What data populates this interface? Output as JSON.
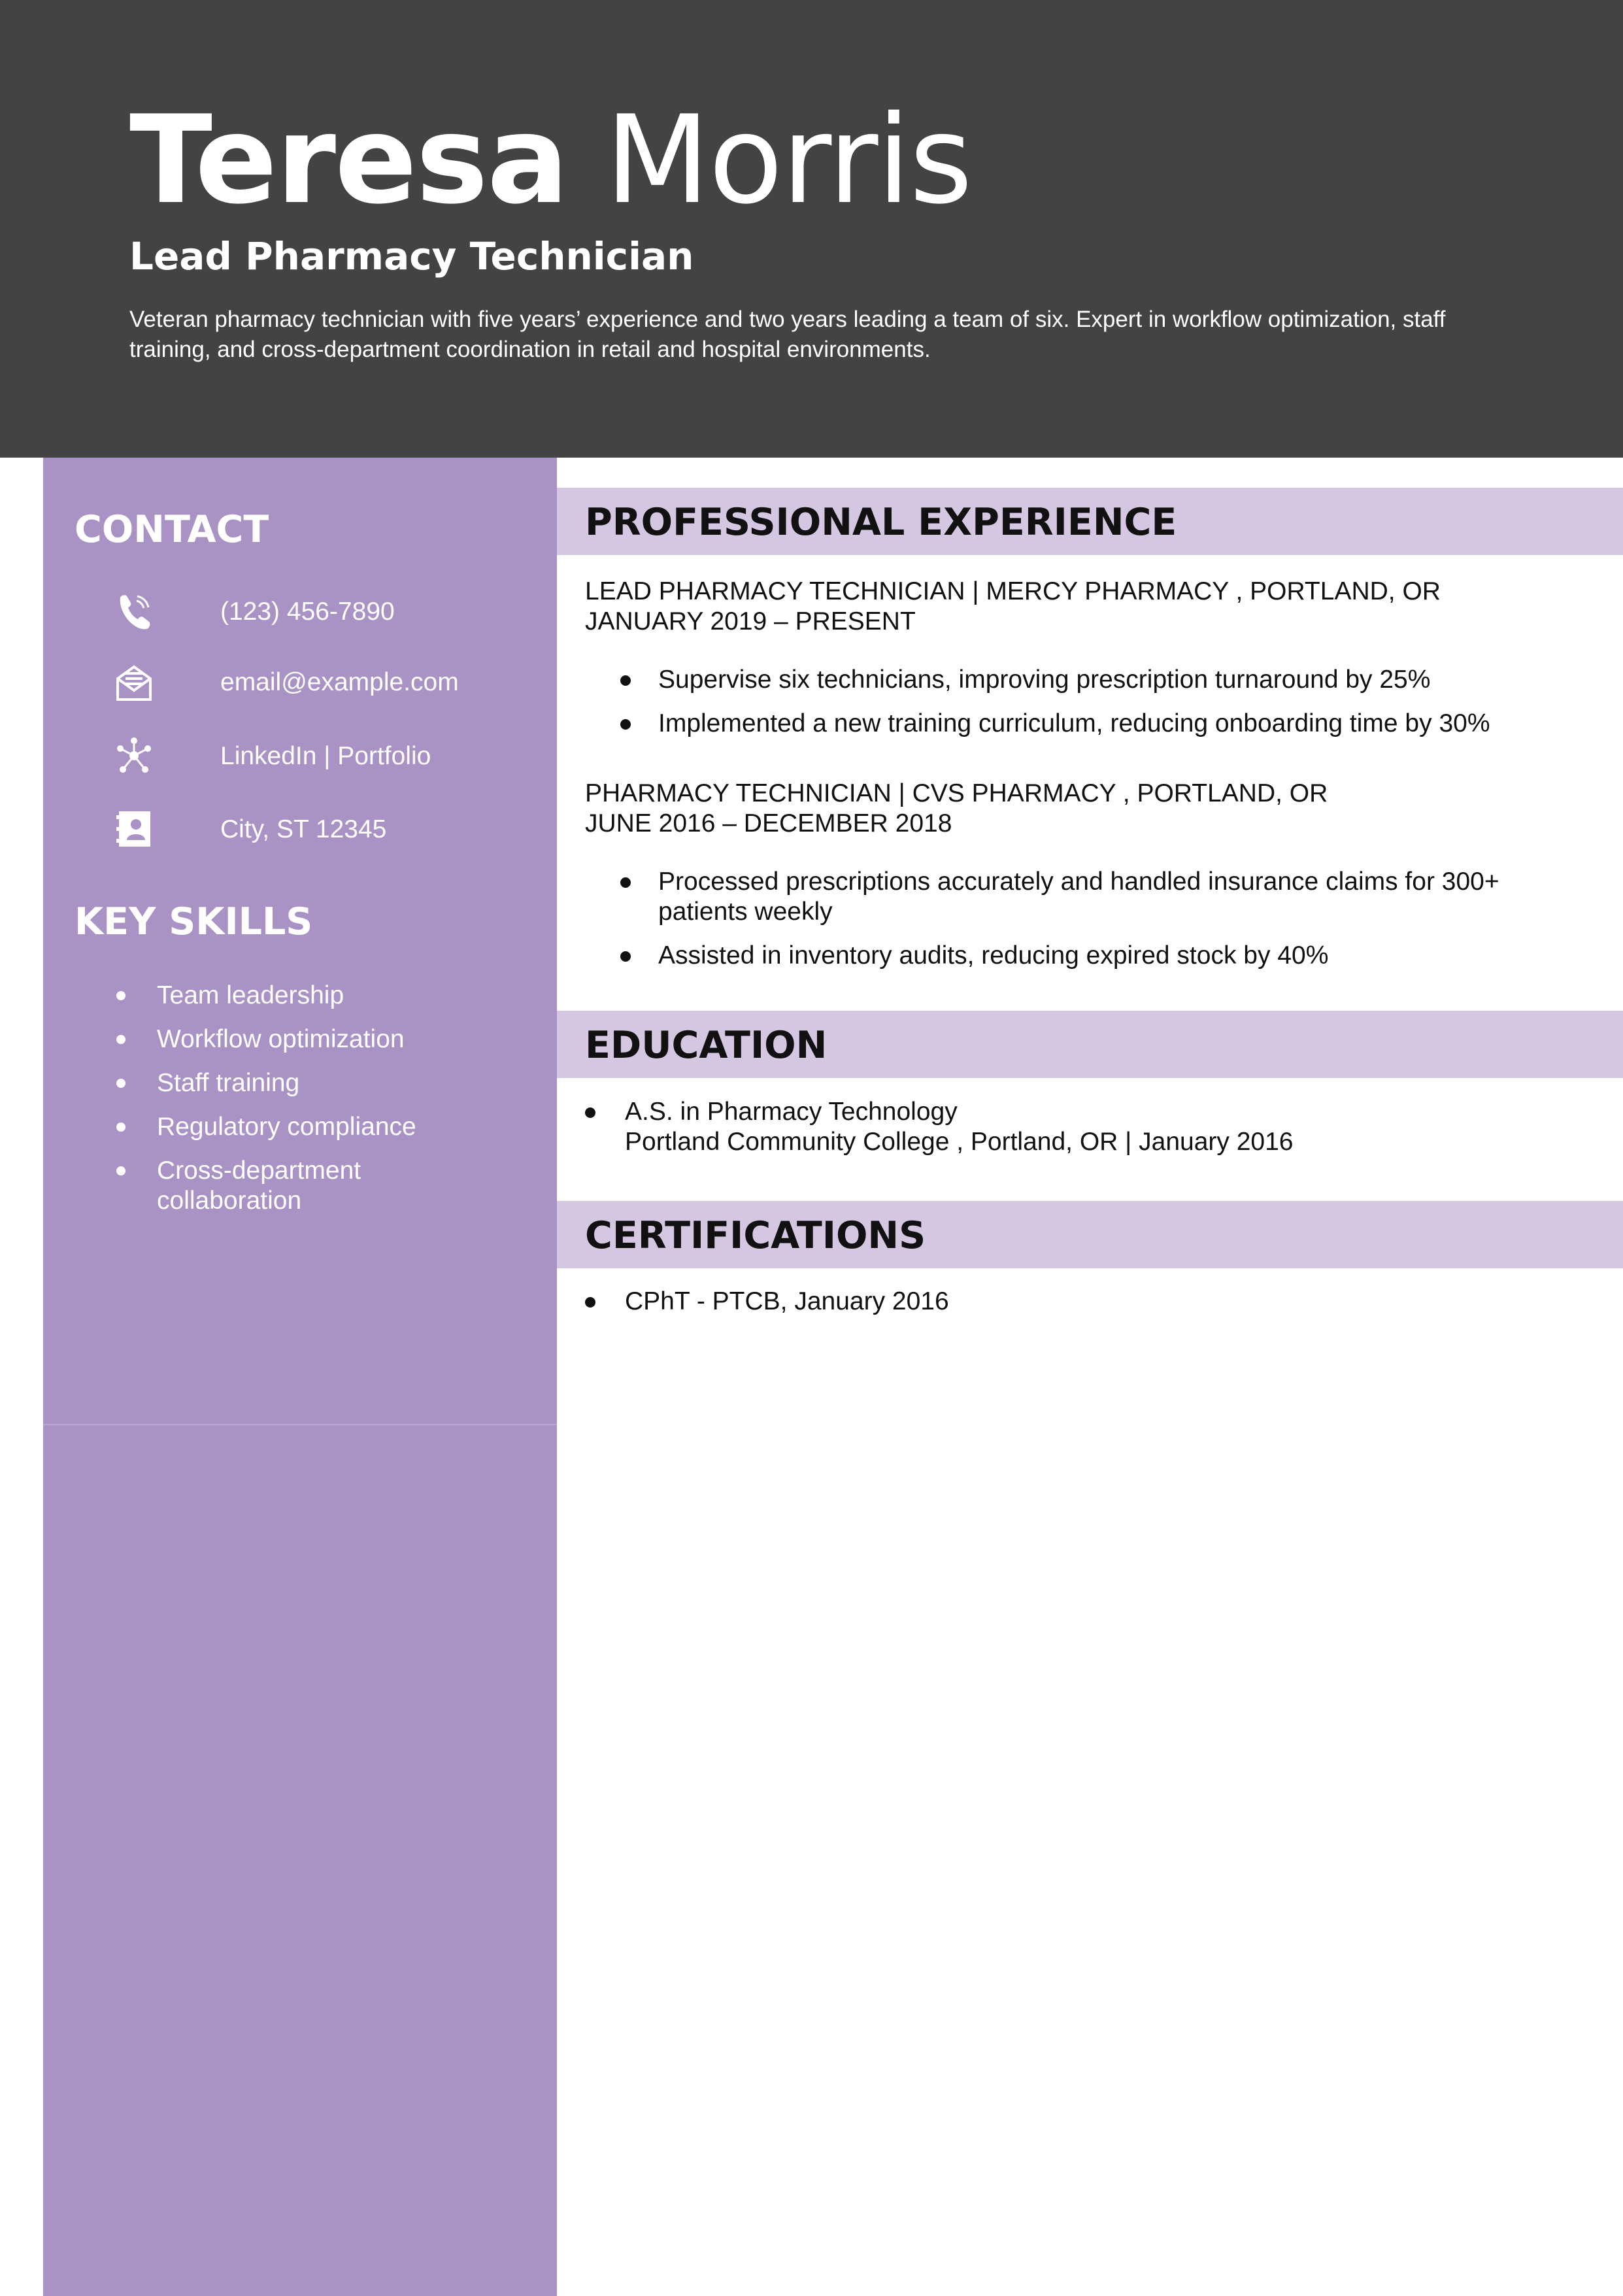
{
  "header": {
    "first_name": "Teresa",
    "last_name": "Morris",
    "job_title": "Lead Pharmacy Technician",
    "summary": "Veteran pharmacy technician with five years’ experience and two years leading a team of six. Expert in workflow optimization, staff training, and cross-department coordination in retail and hospital environments."
  },
  "sidebar": {
    "contact_heading": "CONTACT",
    "contacts": [
      {
        "icon": "phone-icon",
        "label": "(123) 456-7890"
      },
      {
        "icon": "email-icon",
        "label": "email@example.com"
      },
      {
        "icon": "network-icon",
        "label": "LinkedIn | Portfolio"
      },
      {
        "icon": "address-card-icon",
        "label": "City, ST 12345"
      }
    ],
    "skills_heading": "KEY SKILLS",
    "skills": [
      "Team leadership",
      "Workflow optimization",
      "Staff training",
      "Regulatory compliance",
      "Cross-department collaboration"
    ]
  },
  "experience": {
    "heading": "PROFESSIONAL EXPERIENCE",
    "jobs": [
      {
        "title_line": "LEAD PHARMACY TECHNICIAN  | MERCY PHARMACY , PORTLAND, OR",
        "dates": "JANUARY 2019 – PRESENT",
        "bullets": [
          "Supervise six technicians, improving prescription turnaround by 25%",
          "Implemented a new training curriculum, reducing onboarding time by 30%"
        ]
      },
      {
        "title_line": "PHARMACY TECHNICIAN  | CVS PHARMACY , PORTLAND, OR",
        "dates": "JUNE 2016 – DECEMBER 2018",
        "bullets": [
          "Processed prescriptions accurately and handled insurance claims for 300+ patients weekly",
          "Assisted in inventory audits, reducing expired stock by 40%"
        ]
      }
    ]
  },
  "education": {
    "heading": "EDUCATION",
    "degree": "A.S. in Pharmacy Technology",
    "school_line": "Portland Community College , Portland, OR | January 2016"
  },
  "certifications": {
    "heading": "CERTIFICATIONS",
    "items": [
      "CPhT - PTCB, January 2016"
    ]
  },
  "colors": {
    "header_bg": "#434343",
    "sidebar_bg": "#a993c5",
    "section_band": "#d5c7e2"
  }
}
